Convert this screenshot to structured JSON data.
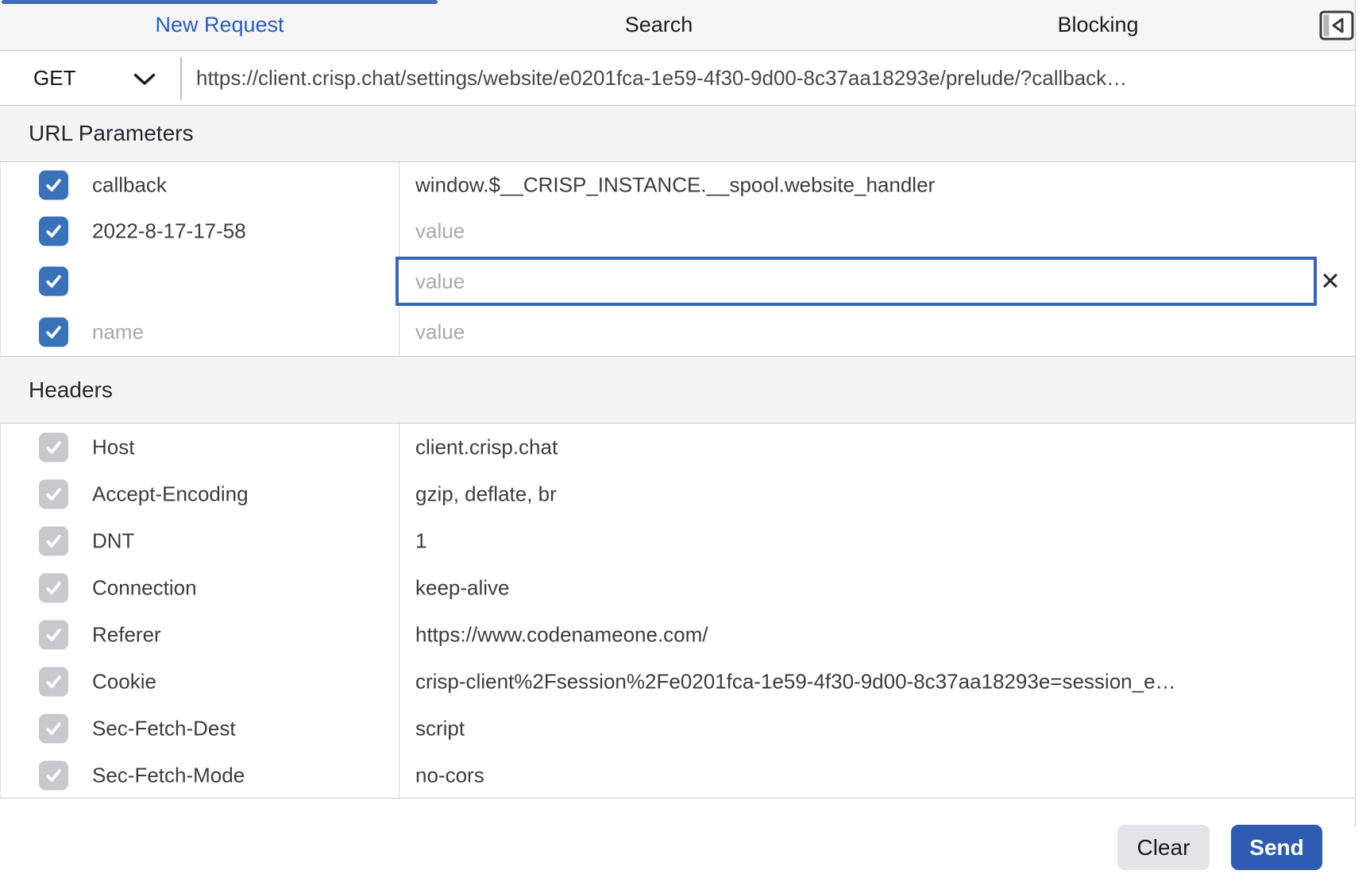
{
  "tab_bar": {
    "tabs": [
      {
        "label": "New Request",
        "active": true
      },
      {
        "label": "Search",
        "active": false
      },
      {
        "label": "Blocking",
        "active": false
      }
    ]
  },
  "request_bar": {
    "method": "GET",
    "url": "https://client.crisp.chat/settings/website/e0201fca-1e59-4f30-9d00-8c37aa18293e/prelude/?callback…"
  },
  "url_parameters": {
    "title": "URL Parameters",
    "rows": [
      {
        "checked": true,
        "enabled": true,
        "name": "callback",
        "value": "window.$__CRISP_INSTANCE.__spool.website_handler"
      },
      {
        "checked": true,
        "enabled": true,
        "name": "2022-8-17-17-58",
        "value_placeholder": "value"
      },
      {
        "checked": true,
        "enabled": true,
        "name": "",
        "value_placeholder": "value",
        "focused": true,
        "has_close_button": true
      },
      {
        "checked": true,
        "enabled": true,
        "name_placeholder": "name",
        "value_placeholder": "value"
      }
    ]
  },
  "headers": {
    "title": "Headers",
    "rows": [
      {
        "checked": true,
        "enabled": false,
        "name": "Host",
        "value": "client.crisp.chat"
      },
      {
        "checked": true,
        "enabled": false,
        "name": "Accept-Encoding",
        "value": "gzip, deflate, br"
      },
      {
        "checked": true,
        "enabled": false,
        "name": "DNT",
        "value": "1"
      },
      {
        "checked": true,
        "enabled": false,
        "name": "Connection",
        "value": "keep-alive"
      },
      {
        "checked": true,
        "enabled": false,
        "name": "Referer",
        "value": "https://www.codenameone.com/"
      },
      {
        "checked": true,
        "enabled": false,
        "name": "Cookie",
        "value": "crisp-client%2Fsession%2Fe0201fca-1e59-4f30-9d00-8c37aa18293e=session_e…"
      },
      {
        "checked": true,
        "enabled": false,
        "name": "Sec-Fetch-Dest",
        "value": "script"
      },
      {
        "checked": true,
        "enabled": false,
        "name": "Sec-Fetch-Mode",
        "value": "no-cors"
      }
    ]
  },
  "footer": {
    "clear_label": "Clear",
    "send_label": "Send"
  },
  "icons": {
    "close_glyph": "✕",
    "sidebar_toggle": "sidebar-collapse-icon",
    "method_chevron": "chevron-down-icon",
    "checkmark": "checkmark-icon"
  },
  "colors": {
    "accent_blue": "#2d5dbe",
    "tab_underline": "#3f6cc0",
    "checkbox_blue": "#3a72ba",
    "checkbox_disabled_gray": "#c9c9cd",
    "focused_input_border": "#3666b4",
    "send_button_blue": "#2e5cb2",
    "placeholder_gray": "#a9a9ad"
  }
}
